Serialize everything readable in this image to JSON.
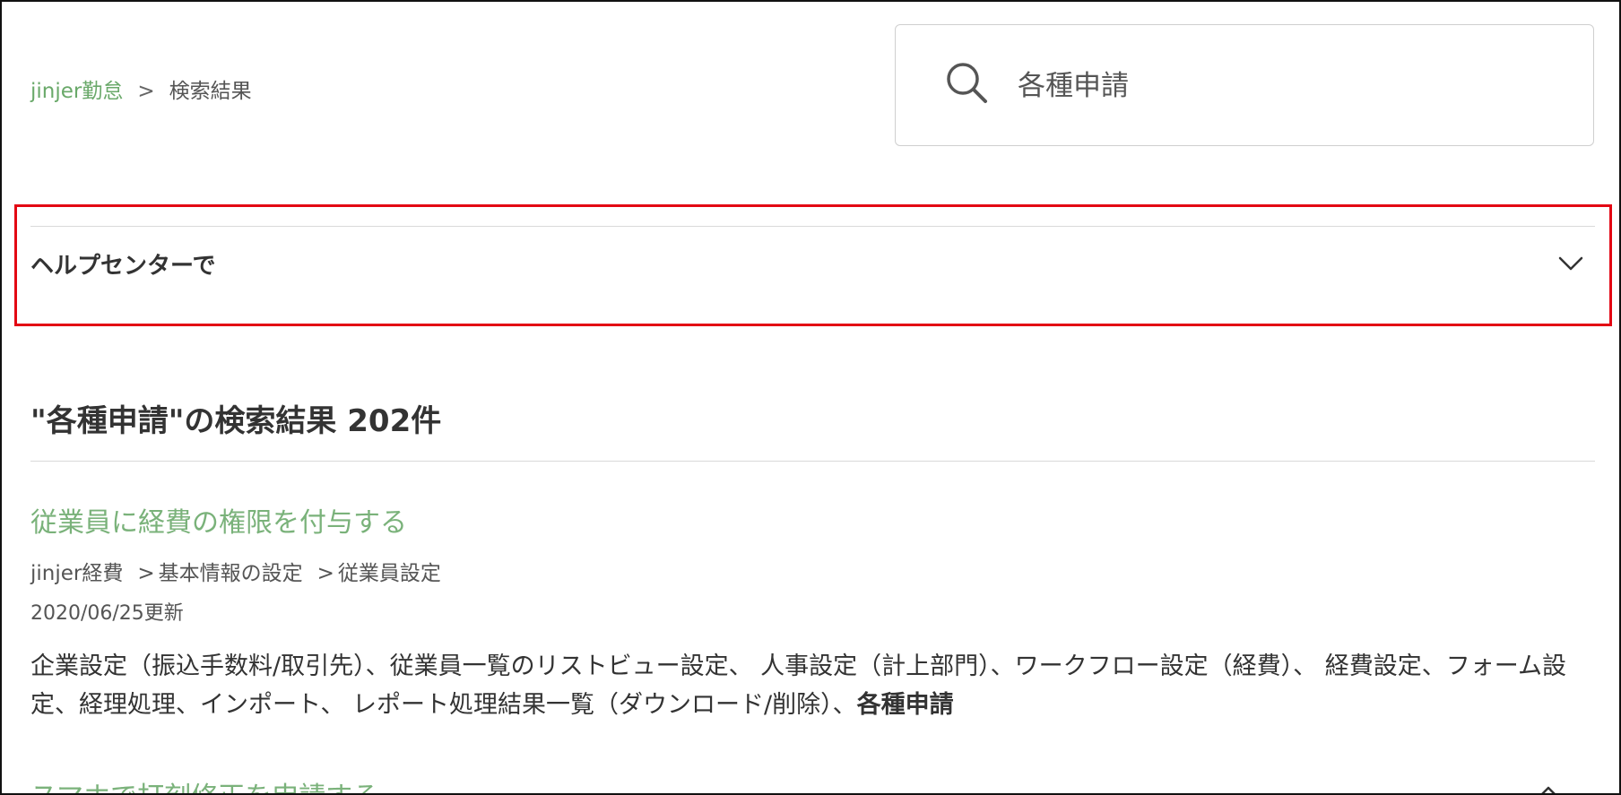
{
  "breadcrumb": {
    "home": "jinjer勤怠",
    "separator": ">",
    "current": "検索結果"
  },
  "search": {
    "value": "各種申請",
    "icon": "search-icon"
  },
  "accordion": {
    "title": "ヘルプセンターで",
    "icon": "chevron-down-icon"
  },
  "results": {
    "heading": "\"各種申請\"の検索結果 202件",
    "items": [
      {
        "title": "従業員に経費の権限を付与する",
        "path": [
          "jinjer経費",
          "基本情報の設定",
          "従業員設定"
        ],
        "path_separator": ">",
        "updated": "2020/06/25更新",
        "snippet": "企業設定（振込手数料/取引先）、従業員一覧のリストビュー設定、 人事設定（計上部門）、ワークフロー設定（経費）、 経費設定、フォーム設定、経理処理、インポート、 レポート処理結果一覧（ダウンロード/削除）、",
        "snippet_highlight": "各種申請"
      },
      {
        "title": "スマホで打刻修正を申請する"
      }
    ]
  },
  "colors": {
    "link_green": "#7ab27a",
    "highlight_red": "#e30613",
    "text": "#333333"
  }
}
